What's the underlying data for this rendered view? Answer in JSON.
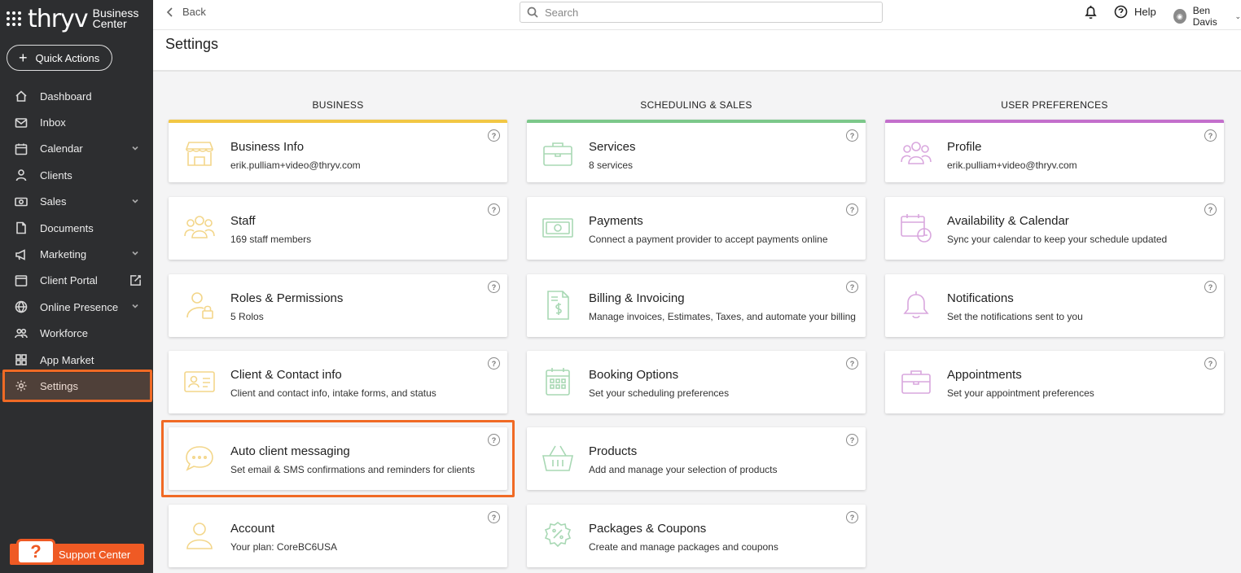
{
  "app": {
    "brand": "thryv",
    "brand_sub_1": "Business",
    "brand_sub_2": "Center"
  },
  "quick_actions": {
    "label": "Quick Actions"
  },
  "sidebar": {
    "items": [
      {
        "label": "Dashboard",
        "icon": "home-icon"
      },
      {
        "label": "Inbox",
        "icon": "mail-icon"
      },
      {
        "label": "Calendar",
        "icon": "calendar-icon",
        "expandable": true
      },
      {
        "label": "Clients",
        "icon": "person-icon"
      },
      {
        "label": "Sales",
        "icon": "money-icon",
        "expandable": true
      },
      {
        "label": "Documents",
        "icon": "document-icon"
      },
      {
        "label": "Marketing",
        "icon": "megaphone-icon",
        "expandable": true
      },
      {
        "label": "Client Portal",
        "icon": "portal-icon"
      },
      {
        "label": "Online Presence",
        "icon": "globe-icon",
        "expandable": true
      },
      {
        "label": "Workforce",
        "icon": "people-icon"
      },
      {
        "label": "App Market",
        "icon": "grid-icon"
      },
      {
        "label": "Settings",
        "icon": "gear-icon",
        "active": true
      }
    ]
  },
  "support": {
    "label": "Support Center"
  },
  "topbar": {
    "back_label": "Back",
    "search_placeholder": "Search",
    "help_label": "Help",
    "user_name": "Ben Davis"
  },
  "page": {
    "title": "Settings"
  },
  "columns": {
    "business": {
      "title": "BUSINESS",
      "accent": "#f2c744",
      "cards": [
        {
          "title": "Business Info",
          "desc": "erik.pulliam+video@thryv.com",
          "icon": "store-icon"
        },
        {
          "title": "Staff",
          "desc": "169 staff members",
          "icon": "staff-icon"
        },
        {
          "title": "Roles & Permissions",
          "desc": "5 Rolos",
          "icon": "user-lock-icon"
        },
        {
          "title": "Client & Contact info",
          "desc": "Client and contact info, intake forms, and status",
          "icon": "id-card-icon"
        },
        {
          "title": "Auto client messaging",
          "desc": "Set email & SMS confirmations and reminders for clients",
          "icon": "chat-bubble-icon"
        },
        {
          "title": "Account",
          "desc": "Your plan: CoreBC6USA",
          "icon": "account-icon"
        }
      ]
    },
    "scheduling": {
      "title": "SCHEDULING & SALES",
      "accent": "#7cc88a",
      "cards": [
        {
          "title": "Services",
          "desc": "8 services",
          "icon": "briefcase-icon"
        },
        {
          "title": "Payments",
          "desc": "Connect a payment provider to accept payments online",
          "icon": "cash-icon"
        },
        {
          "title": "Billing & Invoicing",
          "desc": "Manage invoices, Estimates, Taxes, and automate your billing",
          "icon": "invoice-icon"
        },
        {
          "title": "Booking Options",
          "desc": "Set your scheduling preferences",
          "icon": "calendar-grid-icon"
        },
        {
          "title": "Products",
          "desc": "Add and manage your selection of products",
          "icon": "basket-icon"
        },
        {
          "title": "Packages & Coupons",
          "desc": "Create and manage packages and coupons",
          "icon": "coupon-icon"
        }
      ]
    },
    "preferences": {
      "title": "USER PREFERENCES",
      "accent": "#c36fcc",
      "cards": [
        {
          "title": "Profile",
          "desc": "erik.pulliam+video@thryv.com",
          "icon": "profile-group-icon"
        },
        {
          "title": "Availability & Calendar",
          "desc": "Sync your calendar to keep your schedule updated",
          "icon": "calendar-clock-icon"
        },
        {
          "title": "Notifications",
          "desc": "Set the notifications sent to you",
          "icon": "bell-icon"
        },
        {
          "title": "Appointments",
          "desc": "Set your appointment preferences",
          "icon": "briefcase-icon"
        }
      ]
    }
  }
}
